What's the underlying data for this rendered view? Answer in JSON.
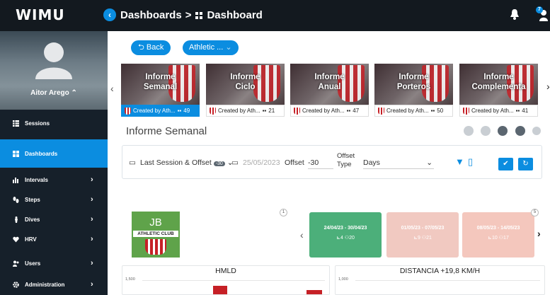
{
  "app": {
    "logo": "WIMU",
    "breadcrumb": {
      "parent": "Dashboards",
      "sep": ">",
      "current": "Dashboard"
    },
    "notification_count": "7"
  },
  "sidebar": {
    "user": "Aitor Arego",
    "items": [
      {
        "label": "Sessions",
        "icon": "table-icon"
      },
      {
        "label": "Dashboards",
        "icon": "dashboard-icon"
      },
      {
        "label": "Intervals",
        "icon": "bar-chart-icon"
      },
      {
        "label": "Steps",
        "icon": "steps-icon"
      },
      {
        "label": "Dives",
        "icon": "dive-icon"
      },
      {
        "label": "HRV",
        "icon": "heart-icon"
      },
      {
        "label": "Users",
        "icon": "users-icon"
      },
      {
        "label": "Administration",
        "icon": "gear-icon"
      }
    ]
  },
  "toolbar": {
    "back": "Back",
    "team": "Athletic ..."
  },
  "cards": [
    {
      "title_l1": "Informe",
      "title_l2": "Semanal",
      "creator": "Created by Ath...",
      "count": "49",
      "active": true
    },
    {
      "title_l1": "Informe",
      "title_l2": "Ciclo",
      "creator": "Created by Ath...",
      "count": "21"
    },
    {
      "title_l1": "Informe",
      "title_l2": "Anual",
      "creator": "Created by Ath...",
      "count": "47"
    },
    {
      "title_l1": "Informe",
      "title_l2": "Porteros",
      "creator": "Created by Ath...",
      "count": "50"
    },
    {
      "title_l1": "Informe",
      "title_l2": "Complementa",
      "creator": "Created by Ath...",
      "count": "41"
    }
  ],
  "section_title": "Informe Semanal",
  "filters": {
    "session": "Last Session & Offset",
    "session_badge": "-30",
    "date": "25/05/2023",
    "offset_label": "Offset",
    "offset_value": "-30",
    "offset_type_l1": "Offset",
    "offset_type_l2": "Type",
    "unit": "Days"
  },
  "team": {
    "abbr": "JB",
    "name": "ATHLETIC CLUB",
    "marker": "1"
  },
  "weeks_marker": "5",
  "weeks": [
    {
      "range": "24/04/23 - 30/04/23",
      "a": "4",
      "b": "20",
      "color": "#4caf7a"
    },
    {
      "range": "01/05/23 - 07/05/23",
      "a": "9",
      "b": "21",
      "color": "#f1c9c1"
    },
    {
      "range": "08/05/23 - 14/05/23",
      "a": "10",
      "b": "17",
      "color": "#f4c7bd"
    }
  ],
  "charts": [
    {
      "title": "HMLD",
      "ytick": "1,500"
    },
    {
      "title": "DISTANCIA +19,8 KM/H",
      "ytick": "1,000"
    }
  ]
}
